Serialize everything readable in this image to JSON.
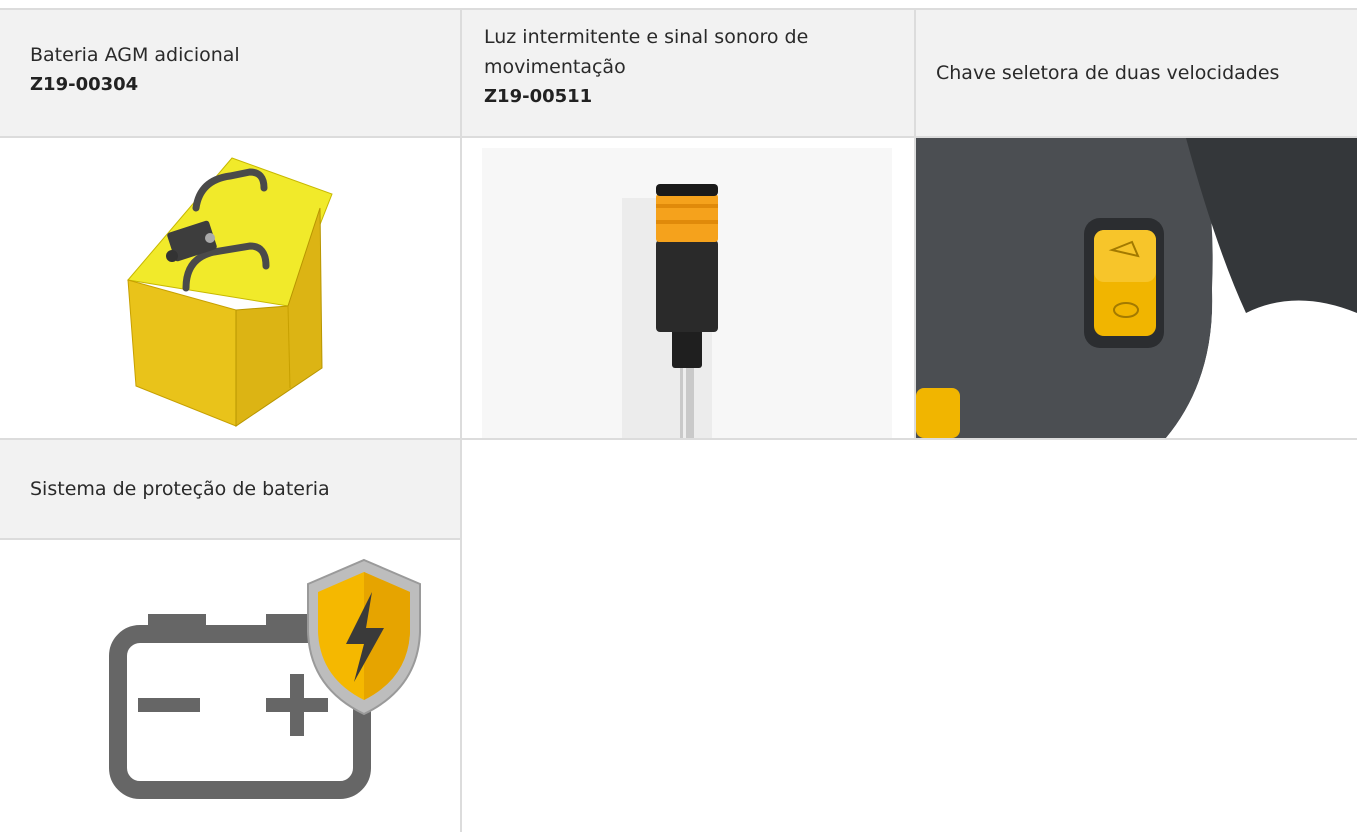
{
  "items": [
    {
      "title": "Bateria AGM adicional",
      "code": "Z19-00304"
    },
    {
      "title": "Luz intermitente e sinal sonoro de movimentação",
      "code": "Z19-00511"
    },
    {
      "title": "Chave seletora de duas velocidades",
      "code": ""
    },
    {
      "title": "Sistema de proteção de bateria",
      "code": ""
    }
  ],
  "icons": [
    "battery-box-icon",
    "signal-tower-light-icon",
    "speed-selector-switch-icon",
    "battery-protection-shield-icon"
  ],
  "colors": {
    "header_bg": "#f2f2f2",
    "grid_line": "#dcdcdc",
    "accent_yellow": "#f5b800",
    "icon_gray": "#666666"
  }
}
